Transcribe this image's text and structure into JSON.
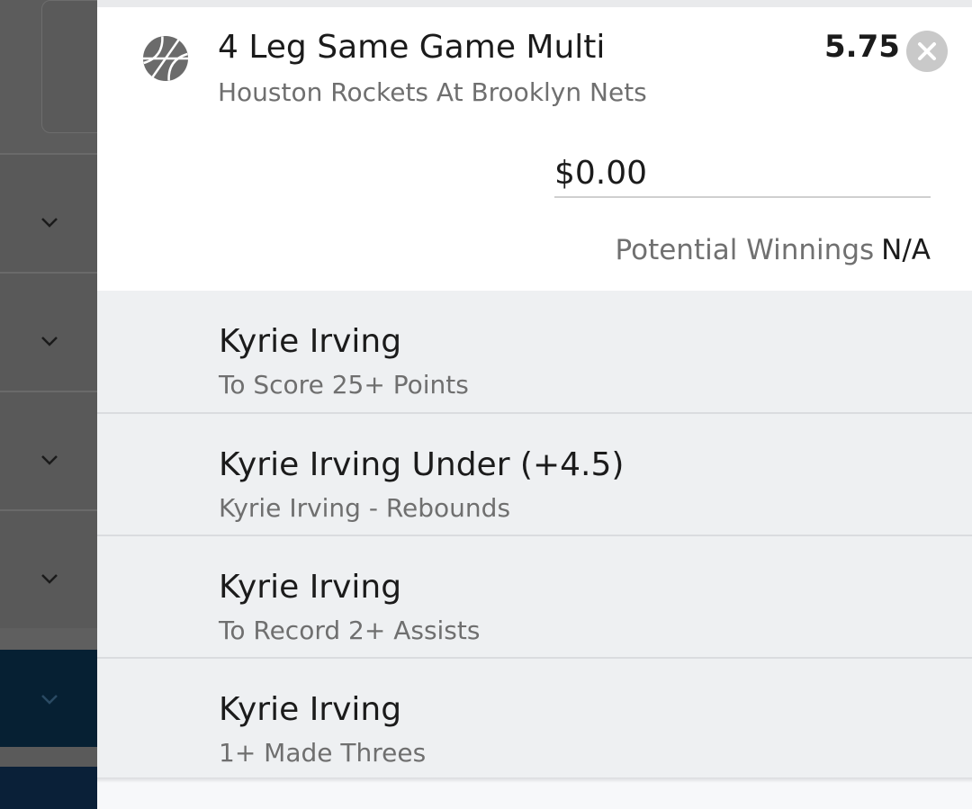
{
  "bet": {
    "title": "4 Leg Same Game Multi",
    "subtitle": "Houston Rockets At Brooklyn Nets",
    "odds": "5.75",
    "stake_placeholder": "$0.00",
    "potential_winnings_label": "Potential Winnings",
    "potential_winnings_value": "N/A",
    "sport_icon": "basketball-icon",
    "close_icon": "close-icon"
  },
  "legs": [
    {
      "name": "Kyrie Irving",
      "desc": "To Score 25+ Points"
    },
    {
      "name": "Kyrie Irving Under (+4.5)",
      "desc": "Kyrie Irving - Rebounds"
    },
    {
      "name": "Kyrie Irving",
      "desc": "To Record 2+ Assists"
    },
    {
      "name": "Kyrie Irving",
      "desc": "1+ Made Threes"
    }
  ],
  "colors": {
    "panel": "#ffffff",
    "legs_bg": "#eef0f2",
    "text_primary": "#1b1b1b",
    "text_secondary": "#6f6f6f",
    "background_navy": "#062033"
  }
}
